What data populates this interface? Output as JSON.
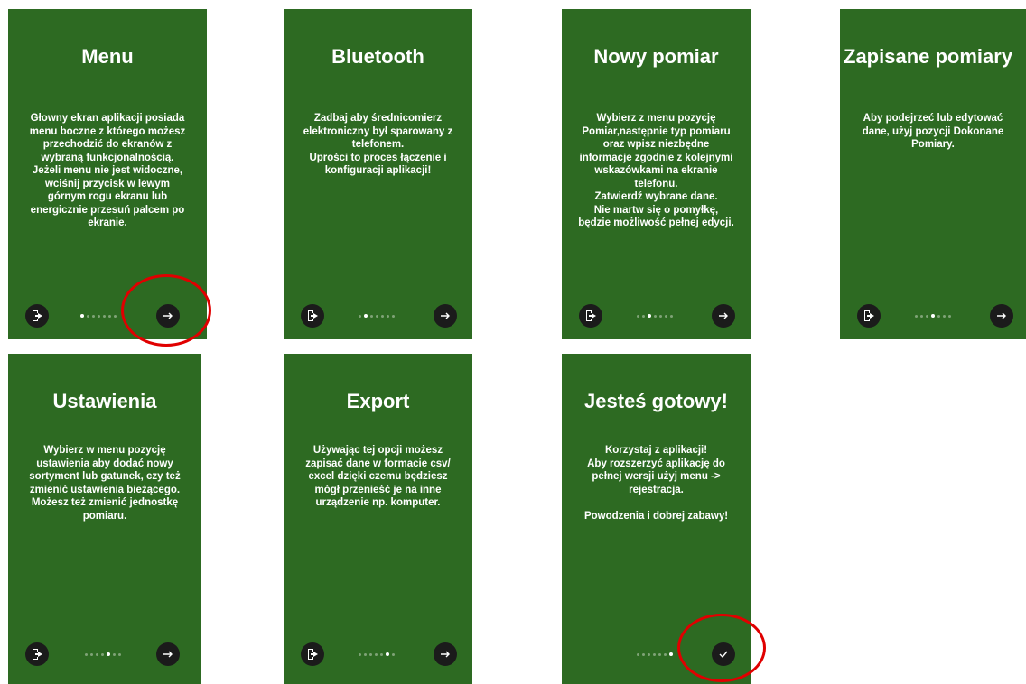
{
  "screens": [
    {
      "title": "Menu",
      "body": "Głowny ekran aplikacji posiada\nmenu boczne z którego możesz\nprzechodzić do ekranów z\nwybraną funkcjonalnością.\nJeżeli menu nie jest widoczne,\nwciśnij przycisk w lewym\ngórnym rogu ekranu lub\nenergicznie przesuń palcem po\nekranie.",
      "active_dot": 0,
      "exit_icon": "exit-door-icon",
      "next_icon": "arrow-right-icon"
    },
    {
      "title": "Bluetooth",
      "body": "Zadbaj aby średnicomierz\nelektroniczny był sparowany z\ntelefonem.\nUprości to proces łączenie i\nkonfiguracji aplikacji!",
      "active_dot": 1,
      "exit_icon": "exit-door-icon",
      "next_icon": "arrow-right-icon"
    },
    {
      "title": "Nowy pomiar",
      "body": "Wybierz z menu pozycję\nPomiar,następnie typ pomiaru\noraz wpisz niezbędne\ninformacje zgodnie z kolejnymi\nwskazówkami na ekranie\ntelefonu.\nZatwierdź wybrane dane.\nNie martw się o pomyłkę,\nbędzie możliwość pełnej edycji.",
      "active_dot": 2,
      "exit_icon": "exit-door-icon",
      "next_icon": "arrow-right-icon"
    },
    {
      "title": "Zapisane pomiary",
      "body": "Aby podejrzeć lub edytować\ndane, użyj pozycji Dokonane\nPomiary.",
      "active_dot": 3,
      "exit_icon": "exit-door-icon",
      "next_icon": "arrow-right-icon"
    },
    {
      "title": "Ustawienia",
      "body": "Wybierz w menu pozycję\nustawienia aby dodać nowy\nsortyment lub gatunek, czy też\nzmienić ustawienia bieżącego.\nMożesz też zmienić jednostkę\npomiaru.",
      "active_dot": 4,
      "exit_icon": "exit-door-icon",
      "next_icon": "arrow-right-icon"
    },
    {
      "title": "Export",
      "body": "Używając tej opcji możesz\nzapisać dane w formacie csv/\nexcel dzięki czemu będziesz\nmógł przenieść je na inne\nurządzenie np. komputer.",
      "active_dot": 5,
      "exit_icon": "exit-door-icon",
      "next_icon": "arrow-right-icon"
    },
    {
      "title": "Jesteś gotowy!",
      "body": "Korzystaj z aplikacji!\nAby rozszerzyć aplikację do\npełnej wersji użyj menu ->\nrejestracja.\n\nPowodzenia i dobrej zabawy!",
      "active_dot": 6,
      "exit_icon": null,
      "next_icon": "checkmark-icon"
    }
  ],
  "colors": {
    "screen_bg": "#2d6a22",
    "button_bg": "#1b1b1b",
    "highlight": "#e00000"
  }
}
